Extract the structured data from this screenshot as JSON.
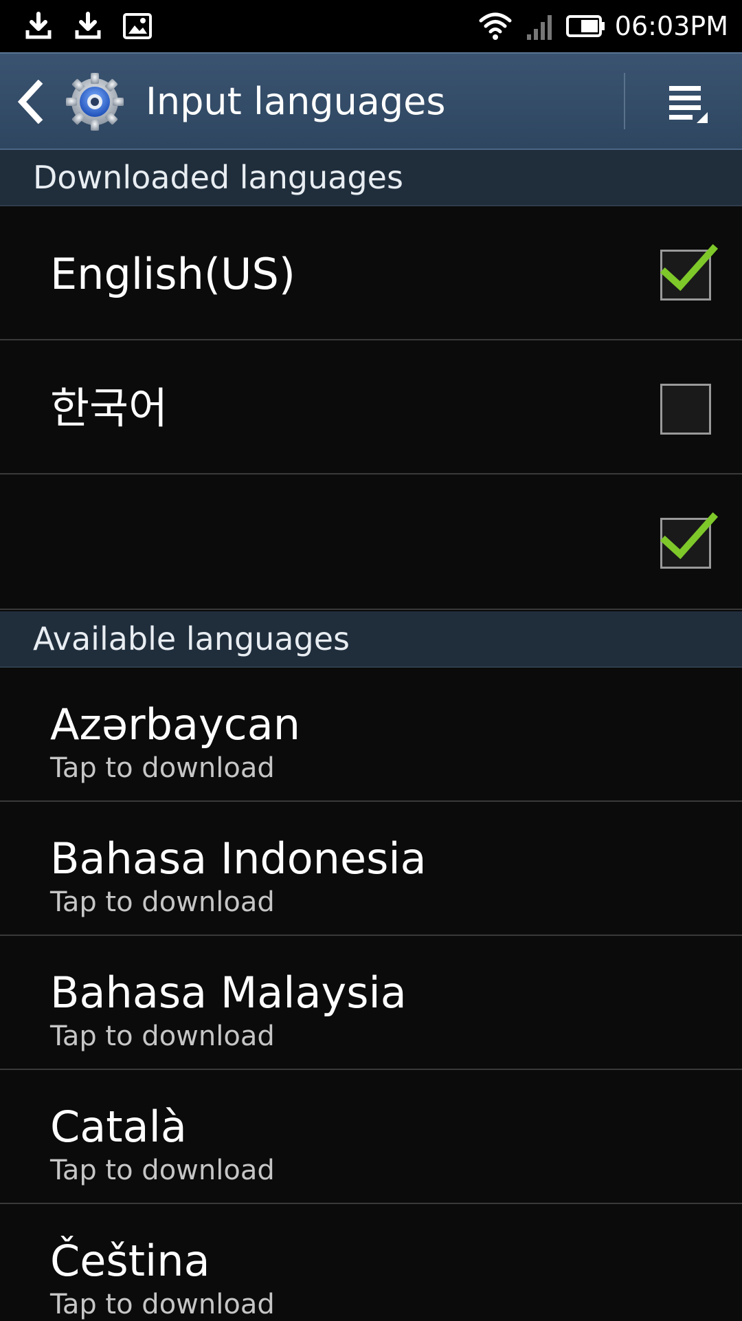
{
  "status_bar": {
    "time": "06:03PM",
    "left_icons": [
      "download-icon",
      "download-icon",
      "image-icon"
    ],
    "right_icons": [
      "wifi-icon",
      "signal-icon",
      "battery-icon"
    ]
  },
  "action_bar": {
    "title": "Input languages",
    "back_icon": "chevron-left-icon",
    "app_icon": "settings-gear-icon",
    "menu_icon": "menu-icon"
  },
  "sections": {
    "downloaded": {
      "header": "Downloaded languages",
      "items": [
        {
          "label": "English(US)",
          "checked": true
        },
        {
          "label": "한국어",
          "checked": false
        },
        {
          "label": "",
          "checked": true
        }
      ]
    },
    "available": {
      "header": "Available languages",
      "items": [
        {
          "label": "Azərbaycan",
          "sub": "Tap to download"
        },
        {
          "label": "Bahasa Indonesia",
          "sub": "Tap to download"
        },
        {
          "label": "Bahasa Malaysia",
          "sub": "Tap to download"
        },
        {
          "label": "Català",
          "sub": "Tap to download"
        },
        {
          "label": "Čeština",
          "sub": "Tap to download"
        }
      ]
    }
  },
  "colors": {
    "action_bar": "#34506b",
    "section_header": "#202e3c",
    "background": "#0b0b0b",
    "checkmark": "#7ec82a"
  }
}
